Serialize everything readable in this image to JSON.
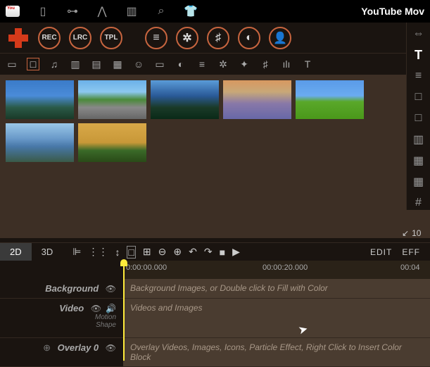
{
  "app": {
    "title": "YouTube Mov"
  },
  "topbar_icons": [
    "bookmark",
    "sliders",
    "peak",
    "columns",
    "search",
    "shirt"
  ],
  "circles": {
    "rec": "REC",
    "lrc": "LRC",
    "tpl": "TPL",
    "list": "≡",
    "flower": "✲",
    "tune": "♯",
    "contrast": "◐",
    "user": "👤"
  },
  "toolbar": [
    "▭",
    "□",
    "♫",
    "▥",
    "▤",
    "▦",
    "☺",
    "▭",
    "◐",
    "≡",
    "✲",
    "✦",
    "♯",
    "ılı",
    "T"
  ],
  "toolbar_right": "⇩",
  "rightcol": [
    "⇔",
    "T",
    "≡",
    "□",
    "□",
    "▥",
    "▦",
    "▦",
    "#"
  ],
  "zoom": {
    "arrow": "↙",
    "value": "10"
  },
  "timeline": {
    "tab2d": "2D",
    "tab3d": "3D",
    "ctrls": [
      "⊫",
      "⋮⋮",
      "↕",
      "□",
      "⊞",
      "⊖",
      "⊕",
      "↶",
      "↷",
      "■",
      "▶"
    ],
    "edit": "EDIT",
    "eff": "EFF"
  },
  "ruler": {
    "t0": "0:00:00.000",
    "t1": "00:00:20.000",
    "t2": "00:04"
  },
  "tracks": {
    "bg": {
      "name": "Background",
      "hint": "Background Images, or Double click to Fill with Color"
    },
    "video": {
      "name": "Video",
      "sub1": "Motion",
      "sub2": "Shape",
      "hint": "Videos and Images"
    },
    "overlay": {
      "name": "Overlay 0",
      "hint": "Overlay Videos, Images, Icons, Particle Effect, Right Click to Insert Color Block"
    }
  }
}
